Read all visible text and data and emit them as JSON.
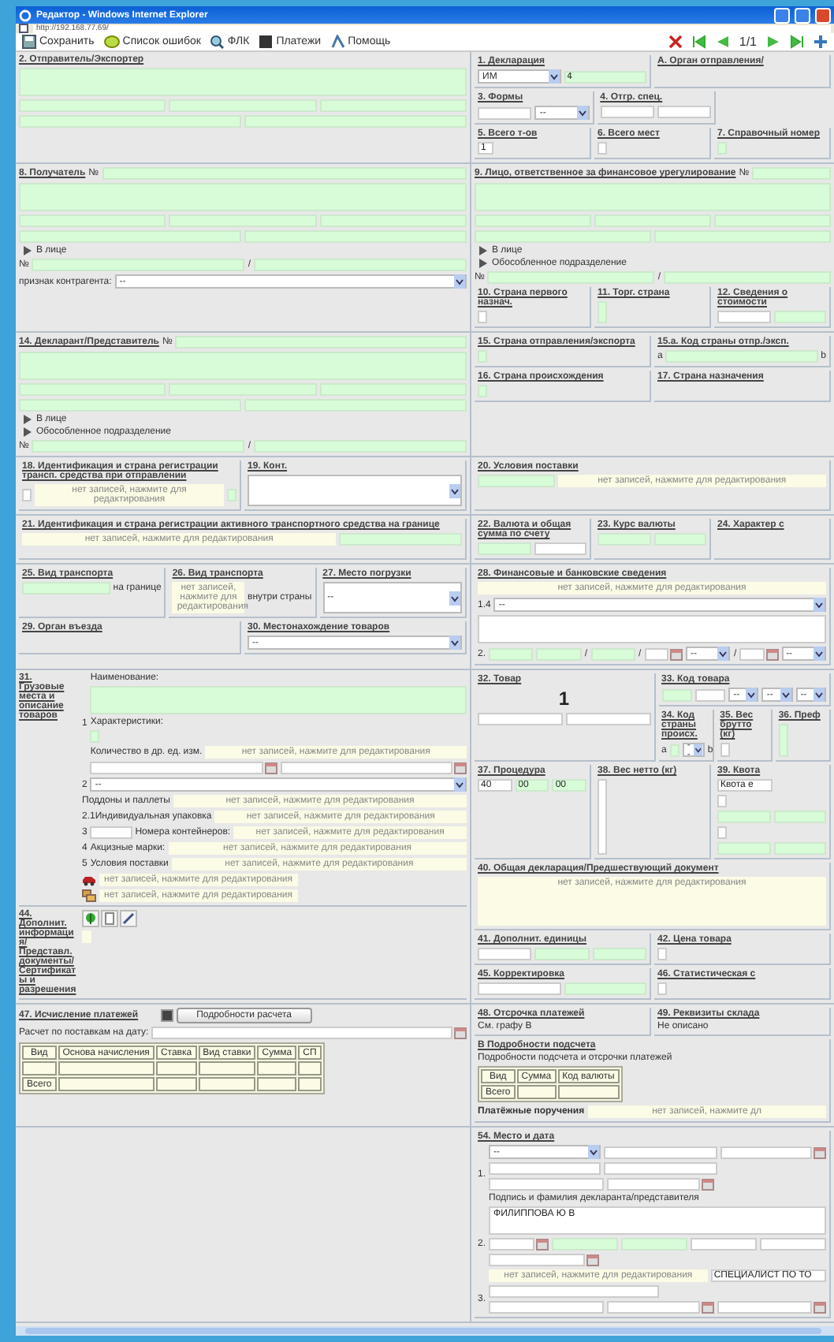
{
  "window": {
    "title": "Редактор - Windows Internet Explorer",
    "address": "http://192.168.77.69/"
  },
  "toolbar": {
    "buttons": [
      {
        "label": "Сохранить"
      },
      {
        "label": "Список ошибок"
      },
      {
        "label": "ФЛК"
      },
      {
        "label": "Платежи"
      },
      {
        "label": "Помощь"
      }
    ],
    "page": "1/1"
  },
  "bands": [
    {
      "left": [
        {
          "kind": "title",
          "text": "2. Отправитель/Экспортер"
        },
        {
          "kind": "textarea",
          "required": true
        },
        {
          "kind": "row",
          "children": [
            {
              "kind": "field",
              "required": true
            },
            {
              "kind": "field",
              "required": true
            },
            {
              "kind": "field",
              "required": true
            }
          ]
        },
        {
          "kind": "row",
          "children": [
            {
              "kind": "field",
              "required": true
            },
            {
              "kind": "field",
              "required": true
            }
          ]
        }
      ],
      "right": [
        {
          "kind": "row",
          "children": [
            {
              "kind": "cell",
              "title": "1. Декларация",
              "children": [
                {
                  "kind": "row",
                  "children": [
                    {
                      "kind": "select",
                      "value": "ИМ"
                    },
                    {
                      "kind": "field",
                      "required": true,
                      "value": "4"
                    }
                  ]
                }
              ]
            },
            {
              "kind": "cell",
              "title": "A. Орган отправления/"
            }
          ]
        },
        {
          "kind": "row",
          "children": [
            {
              "kind": "cell",
              "title": "3. Формы",
              "children": [
                {
                  "kind": "row",
                  "children": [
                    {
                      "kind": "field",
                      "required": false
                    },
                    {
                      "kind": "select",
                      "value": "--"
                    }
                  ]
                }
              ]
            },
            {
              "kind": "cell",
              "title": "4. Отгр. спец.",
              "children": [
                {
                  "kind": "row",
                  "children": [
                    {
                      "kind": "field",
                      "required": false
                    },
                    {
                      "kind": "field",
                      "required": false
                    }
                  ]
                }
              ]
            },
            {
              "kind": "cell"
            }
          ]
        },
        {
          "kind": "row",
          "children": [
            {
              "kind": "cell",
              "title": "5. Всего т-ов",
              "children": [
                {
                  "kind": "field",
                  "required": false,
                  "value": "1"
                }
              ]
            },
            {
              "kind": "cell",
              "title": "6. Всего мест",
              "children": [
                {
                  "kind": "field",
                  "required": false
                }
              ]
            },
            {
              "kind": "cell",
              "title": "7. Справочный номер",
              "children": [
                {
                  "kind": "field",
                  "required": true
                }
              ]
            }
          ]
        }
      ]
    },
    {
      "left": [
        {
          "kind": "row",
          "children": [
            {
              "kind": "title",
              "text": "8. Получатель"
            },
            {
              "kind": "text",
              "text": "№"
            },
            {
              "kind": "field",
              "required": true
            }
          ]
        },
        {
          "kind": "textarea",
          "required": true
        },
        {
          "kind": "row",
          "children": [
            {
              "kind": "field",
              "required": true
            },
            {
              "kind": "field",
              "required": true
            },
            {
              "kind": "field",
              "required": true
            }
          ]
        },
        {
          "kind": "row",
          "children": [
            {
              "kind": "field",
              "required": true
            },
            {
              "kind": "field",
              "required": true
            }
          ]
        },
        {
          "kind": "expander",
          "text": "В лице",
          "expanded": false
        },
        {
          "kind": "row",
          "children": [
            {
              "kind": "text",
              "text": "№"
            },
            {
              "kind": "field",
              "required": true
            },
            {
              "kind": "text",
              "text": "/"
            },
            {
              "kind": "field",
              "required": true
            }
          ]
        },
        {
          "kind": "row",
          "children": [
            {
              "kind": "text",
              "text": "признак контрагента:"
            },
            {
              "kind": "select",
              "value": "--"
            }
          ]
        }
      ],
      "right": [
        {
          "kind": "row",
          "children": [
            {
              "kind": "title",
              "text": "9. Лицо, ответственное за финансовое урегулирование"
            },
            {
              "kind": "text",
              "text": "№"
            },
            {
              "kind": "field",
              "required": true
            }
          ]
        },
        {
          "kind": "textarea",
          "required": true
        },
        {
          "kind": "row",
          "children": [
            {
              "kind": "field",
              "required": true
            },
            {
              "kind": "field",
              "required": true
            },
            {
              "kind": "field",
              "required": true
            }
          ]
        },
        {
          "kind": "row",
          "children": [
            {
              "kind": "field",
              "required": true
            },
            {
              "kind": "field",
              "required": true
            }
          ]
        },
        {
          "kind": "expander",
          "text": "В лице",
          "expanded": false
        },
        {
          "kind": "expander",
          "text": "Обособленное подразделение",
          "expanded": false
        },
        {
          "kind": "row",
          "children": [
            {
              "kind": "text",
              "text": "№"
            },
            {
              "kind": "field",
              "required": true
            },
            {
              "kind": "text",
              "text": "/"
            },
            {
              "kind": "field",
              "required": true
            }
          ]
        },
        {
          "kind": "row",
          "children": [
            {
              "kind": "cell",
              "title": "10. Страна первого назнач.",
              "children": [
                {
                  "kind": "field",
                  "required": false
                }
              ]
            },
            {
              "kind": "cell",
              "title": "11. Торг. страна",
              "children": [
                {
                  "kind": "field",
                  "required": true
                }
              ]
            },
            {
              "kind": "cell",
              "title": "12. Сведения о стоимости",
              "children": [
                {
                  "kind": "row",
                  "children": [
                    {
                      "kind": "field",
                      "required": false
                    },
                    {
                      "kind": "field",
                      "required": true
                    }
                  ]
                }
              ]
            }
          ]
        }
      ]
    },
    {
      "left": [
        {
          "kind": "row",
          "children": [
            {
              "kind": "title",
              "text": "14. Декларант/Представитель"
            },
            {
              "kind": "text",
              "text": "№"
            },
            {
              "kind": "field",
              "required": true
            }
          ]
        },
        {
          "kind": "textarea",
          "required": true
        },
        {
          "kind": "row",
          "children": [
            {
              "kind": "field",
              "required": true
            },
            {
              "kind": "field",
              "required": true
            },
            {
              "kind": "field",
              "required": true
            }
          ]
        },
        {
          "kind": "row",
          "children": [
            {
              "kind": "field",
              "required": true
            },
            {
              "kind": "field",
              "required": true
            }
          ]
        },
        {
          "kind": "expander",
          "text": "В лице",
          "expanded": false
        },
        {
          "kind": "expander",
          "text": "Обособленное подразделение",
          "expanded": false
        },
        {
          "kind": "row",
          "children": [
            {
              "kind": "text",
              "text": "№"
            },
            {
              "kind": "field",
              "required": true
            },
            {
              "kind": "text",
              "text": "/"
            },
            {
              "kind": "field",
              "required": true
            }
          ]
        }
      ],
      "right": [
        {
          "kind": "row",
          "children": [
            {
              "kind": "cell",
              "title": "15. Страна отправления/экспорта",
              "children": [
                {
                  "kind": "field",
                  "required": true
                }
              ]
            },
            {
              "kind": "cell",
              "title": "15.a. Код страны отпр./эксп.",
              "children": [
                {
                  "kind": "row",
                  "children": [
                    {
                      "kind": "text",
                      "text": "a"
                    },
                    {
                      "kind": "field",
                      "required": true
                    },
                    {
                      "kind": "text",
                      "text": "b"
                    }
                  ]
                }
              ]
            }
          ]
        },
        {
          "kind": "row",
          "children": [
            {
              "kind": "cell",
              "title": "16. Страна происхождения",
              "children": [
                {
                  "kind": "field",
                  "required": true
                }
              ]
            },
            {
              "kind": "cell",
              "title": "17. Страна назначения"
            }
          ]
        }
      ]
    },
    {
      "left": [
        {
          "kind": "row",
          "children": [
            {
              "kind": "cell",
              "title": "18. Идентификация и страна регистрации трансп. средства при отправлении",
              "children": [
                {
                  "kind": "row",
                  "children": [
                    {
                      "kind": "field",
                      "required": false
                    },
                    {
                      "kind": "note",
                      "text": "нет записей, нажмите для редактирования"
                    },
                    {
                      "kind": "field",
                      "required": true
                    }
                  ]
                }
              ]
            },
            {
              "kind": "cell",
              "title": "19. Конт.",
              "children": [
                {
                  "kind": "select"
                }
              ]
            }
          ]
        }
      ],
      "right": [
        {
          "kind": "cell",
          "title": "20. Условия поставки",
          "children": [
            {
              "kind": "row",
              "children": [
                {
                  "kind": "field",
                  "required": true
                },
                {
                  "kind": "note",
                  "text": "нет записей, нажмите для редактирования"
                }
              ]
            }
          ]
        }
      ]
    },
    {
      "left": [
        {
          "kind": "cell",
          "title": "21. Идентификация и страна регистрации активного транспортного средства на границе",
          "children": [
            {
              "kind": "row",
              "children": [
                {
                  "kind": "note",
                  "text": "нет записей, нажмите для редактирования"
                },
                {
                  "kind": "field",
                  "required": true
                }
              ]
            }
          ]
        }
      ],
      "right": [
        {
          "kind": "row",
          "children": [
            {
              "kind": "cell",
              "title": "22. Валюта и общая сумма по счету",
              "children": [
                {
                  "kind": "row",
                  "children": [
                    {
                      "kind": "field",
                      "required": true
                    },
                    {
                      "kind": "field",
                      "required": false
                    }
                  ]
                }
              ]
            },
            {
              "kind": "cell",
              "title": "23. Курс валюты",
              "children": [
                {
                  "kind": "row",
                  "children": [
                    {
                      "kind": "field",
                      "required": true
                    },
                    {
                      "kind": "field",
                      "required": true
                    }
                  ]
                }
              ]
            },
            {
              "kind": "cell",
              "title": "24. Характер с"
            }
          ]
        }
      ]
    },
    {
      "left": [
        {
          "kind": "row",
          "children": [
            {
              "kind": "cell",
              "title": "25. Вид транспорта",
              "children": [
                {
                  "kind": "row",
                  "children": [
                    {
                      "kind": "field",
                      "required": true
                    },
                    {
                      "kind": "text",
                      "text": "на границе"
                    }
                  ]
                }
              ]
            },
            {
              "kind": "cell",
              "title": "26. Вид транспорта",
              "children": [
                {
                  "kind": "row",
                  "children": [
                    {
                      "kind": "note",
                      "text": "нет записей, нажмите для редактирования"
                    },
                    {
                      "kind": "text",
                      "text": "внутри страны"
                    }
                  ]
                }
              ]
            },
            {
              "kind": "cell",
              "title": "27. Место погрузки",
              "children": [
                {
                  "kind": "select",
                  "value": "--"
                }
              ]
            }
          ]
        },
        {
          "kind": "row",
          "children": [
            {
              "kind": "cell",
              "title": "29. Орган въезда"
            },
            {
              "kind": "cell",
              "title": "30. Местонахождение товаров",
              "children": [
                {
                  "kind": "select",
                  "value": "--"
                }
              ]
            }
          ]
        }
      ],
      "right": [
        {
          "kind": "cell",
          "title": "28. Финансовые и банковские сведения",
          "children": [
            {
              "kind": "note",
              "text": "нет записей, нажмите для редактирования"
            },
            {
              "kind": "row",
              "children": [
                {
                  "kind": "text",
                  "text": "1.4"
                },
                {
                  "kind": "select",
                  "value": "--"
                }
              ]
            },
            {
              "kind": "textarea",
              "required": false
            },
            {
              "kind": "row",
              "children": [
                {
                  "kind": "text",
                  "text": "2."
                },
                {
                  "kind": "field",
                  "required": true
                },
                {
                  "kind": "field",
                  "required": true
                },
                {
                  "kind": "text",
                  "text": "/"
                },
                {
                  "kind": "field",
                  "required": true
                },
                {
                  "kind": "text",
                  "text": "/"
                },
                {
                  "kind": "date"
                },
                {
                  "kind": "select",
                  "value": "--"
                },
                {
                  "kind": "text",
                  "text": "/"
                },
                {
                  "kind": "date"
                },
                {
                  "kind": "select",
                  "value": "--"
                }
              ]
            }
          ]
        }
      ]
    },
    {
      "left": [
        {
          "kind": "side",
          "title": "31. Грузовые места и описание товаров",
          "children": [
            {
              "kind": "row",
              "children": [
                {
                  "kind": "text",
                  "text": "1"
                },
                {
                  "kind": "col",
                  "children": [
                    {
                      "kind": "text",
                      "text": "Наименование:"
                    },
                    {
                      "kind": "textarea",
                      "required": true
                    },
                    {
                      "kind": "text",
                      "text": "Характеристики:"
                    },
                    {
                      "kind": "field",
                      "required": true
                    },
                    {
                      "kind": "row",
                      "children": [
                        {
                          "kind": "text",
                          "text": "Количество в др. ед. изм."
                        },
                        {
                          "kind": "note",
                          "text": "нет записей, нажмите для редактирования"
                        }
                      ]
                    },
                    {
                      "kind": "row",
                      "children": [
                        {
                          "kind": "date"
                        },
                        {
                          "kind": "date"
                        }
                      ]
                    }
                  ]
                }
              ]
            },
            {
              "kind": "row",
              "children": [
                {
                  "kind": "text",
                  "text": "2"
                },
                {
                  "kind": "select",
                  "value": "--"
                }
              ]
            },
            {
              "kind": "row",
              "children": [
                {
                  "kind": "text",
                  "text": "Поддоны и паллеты"
                },
                {
                  "kind": "note",
                  "text": "нет записей, нажмите для редактирования"
                }
              ]
            },
            {
              "kind": "row",
              "children": [
                {
                  "kind": "text",
                  "text": "2.1Индивидуальная упаковка"
                },
                {
                  "kind": "note",
                  "text": "нет записей, нажмите для редактирования"
                }
              ]
            },
            {
              "kind": "row",
              "children": [
                {
                  "kind": "text",
                  "text": "3"
                },
                {
                  "kind": "field",
                  "required": false
                },
                {
                  "kind": "text",
                  "text": "Номера контейнеров:"
                },
                {
                  "kind": "note",
                  "text": "нет записей, нажмите для редактирования"
                }
              ]
            },
            {
              "kind": "row",
              "children": [
                {
                  "kind": "text",
                  "text": "4"
                },
                {
                  "kind": "text",
                  "text": "Акцизные марки:"
                },
                {
                  "kind": "note",
                  "text": "нет записей, нажмите для редактирования"
                }
              ]
            },
            {
              "kind": "row",
              "children": [
                {
                  "kind": "text",
                  "text": "5"
                },
                {
                  "kind": "text",
                  "text": "Условия поставки"
                },
                {
                  "kind": "note",
                  "text": "нет записей, нажмите для редактирования"
                }
              ]
            },
            {
              "kind": "vehicle",
              "text": "нет записей, нажмите для редактирования"
            },
            {
              "kind": "cargo",
              "text": "нет записей, нажмите для редактирования"
            }
          ]
        },
        {
          "kind": "side",
          "title": "44. Дополнит. информация/ Представл. документы/ Сертификаты и разрешения",
          "children": [
            {
              "kind": "iconbar"
            }
          ]
        }
      ],
      "right": [
        {
          "kind": "row",
          "children": [
            {
              "kind": "cell",
              "title": "32. Товар",
              "children": [
                {
                  "kind": "number",
                  "text": "1"
                },
                {
                  "kind": "row",
                  "children": [
                    {
                      "kind": "field",
                      "required": false
                    },
                    {
                      "kind": "field",
                      "required": false
                    }
                  ]
                }
              ]
            },
            {
              "kind": "col",
              "children": [
                {
                  "kind": "cell",
                  "title": "33. Код товара",
                  "children": [
                    {
                      "kind": "row",
                      "children": [
                        {
                          "kind": "field",
                          "required": true
                        },
                        {
                          "kind": "field",
                          "required": false
                        },
                        {
                          "kind": "select",
                          "value": "--"
                        },
                        {
                          "kind": "select",
                          "value": "--"
                        },
                        {
                          "kind": "select",
                          "value": "--"
                        }
                      ]
                    }
                  ]
                },
                {
                  "kind": "row",
                  "children": [
                    {
                      "kind": "cell",
                      "title": "34. Код страны происх.",
                      "children": [
                        {
                          "kind": "row",
                          "children": [
                            {
                              "kind": "text",
                              "text": "a"
                            },
                            {
                              "kind": "field",
                              "required": true
                            },
                            {
                              "kind": "select",
                              "value": "--"
                            },
                            {
                              "kind": "text",
                              "text": "b"
                            }
                          ]
                        }
                      ]
                    },
                    {
                      "kind": "cell",
                      "title": "35. Вес брутто (кг)",
                      "children": [
                        {
                          "kind": "field",
                          "required": false
                        }
                      ]
                    },
                    {
                      "kind": "cell",
                      "title": "36. Преф",
                      "children": [
                        {
                          "kind": "field",
                          "required": true
                        }
                      ]
                    }
                  ]
                }
              ]
            }
          ]
        },
        {
          "kind": "row",
          "children": [
            {
              "kind": "cell",
              "title": "37. Процедура",
              "children": [
                {
                  "kind": "row",
                  "children": [
                    {
                      "kind": "field",
                      "required": false,
                      "value": "40"
                    },
                    {
                      "kind": "field",
                      "required": true,
                      "value": "00"
                    },
                    {
                      "kind": "field",
                      "required": true,
                      "value": "00"
                    }
                  ]
                }
              ]
            },
            {
              "kind": "cell",
              "title": "38. Вес нетто (кг)",
              "children": [
                {
                  "kind": "field",
                  "required": false
                }
              ]
            },
            {
              "kind": "cell",
              "title": "39. Квота",
              "children": [
                {
                  "kind": "field",
                  "required": false,
                  "value": "Квота е"
                },
                {
                  "kind": "field",
                  "required": false
                },
                {
                  "kind": "row",
                  "children": [
                    {
                      "kind": "field",
                      "required": true
                    },
                    {
                      "kind": "field",
                      "required": true
                    }
                  ]
                },
                {
                  "kind": "field",
                  "required": false
                },
                {
                  "kind": "row",
                  "children": [
                    {
                      "kind": "field",
                      "required": true
                    },
                    {
                      "kind": "field",
                      "required": true
                    }
                  ]
                }
              ]
            }
          ]
        },
        {
          "kind": "cell",
          "title": "40. Общая декларация/Предшествующий документ",
          "children": [
            {
              "kind": "note",
              "text": "нет записей, нажмите для редактирования"
            }
          ]
        },
        {
          "kind": "row",
          "children": [
            {
              "kind": "cell",
              "title": "41. Дополнит. единицы",
              "children": [
                {
                  "kind": "row",
                  "children": [
                    {
                      "kind": "field",
                      "required": false
                    },
                    {
                      "kind": "field",
                      "required": true
                    },
                    {
                      "kind": "field",
                      "required": true
                    }
                  ]
                }
              ]
            },
            {
              "kind": "cell",
              "title": "42. Цена товара",
              "children": [
                {
                  "kind": "field",
                  "required": false
                }
              ]
            }
          ]
        },
        {
          "kind": "row",
          "children": [
            {
              "kind": "cell",
              "title": "45. Корректировка",
              "children": [
                {
                  "kind": "row",
                  "children": [
                    {
                      "kind": "field",
                      "required": false
                    },
                    {
                      "kind": "field",
                      "required": true
                    }
                  ]
                }
              ]
            },
            {
              "kind": "cell",
              "title": "46. Статистическая с",
              "children": [
                {
                  "kind": "field",
                  "required": false
                }
              ]
            }
          ]
        }
      ]
    },
    {
      "left": [
        {
          "kind": "row",
          "children": [
            {
              "kind": "title",
              "text": "47. Исчисление платежей"
            },
            {
              "kind": "button",
              "text": "Подробности расчета"
            }
          ]
        },
        {
          "kind": "row",
          "children": [
            {
              "kind": "text",
              "text": "Расчет по поставкам на дату:"
            },
            {
              "kind": "date"
            }
          ]
        },
        {
          "kind": "table",
          "columns": [
            "Вид",
            "Основа начисления",
            "Ставка",
            "Вид ставки",
            "Сумма",
            "СП"
          ],
          "rows": [
            {
              "kind": "blank"
            },
            {
              "kind": "total",
              "label": "Всего"
            }
          ]
        }
      ],
      "right": [
        {
          "kind": "row",
          "children": [
            {
              "kind": "cell",
              "title": "48. Отсрочка платежей",
              "children": [
                {
                  "kind": "text",
                  "text": "См. графу B"
                }
              ]
            },
            {
              "kind": "cell",
              "title": "49. Реквизиты склада",
              "children": [
                {
                  "kind": "text",
                  "text": "Не описано"
                }
              ]
            }
          ]
        },
        {
          "kind": "cell",
          "title": "B Подробности подсчета",
          "children": [
            {
              "kind": "text",
              "text": "Подробности подсчета и отсрочки платежей"
            },
            {
              "kind": "table",
              "columns": [
                "Вид",
                "Сумма",
                "Код валюты"
              ],
              "rows": [
                {
                  "kind": "total",
                  "label": "Всего"
                }
              ]
            },
            {
              "kind": "row",
              "children": [
                {
                  "kind": "heading",
                  "text": "Платёжные поручения"
                },
                {
                  "kind": "note",
                  "text": "нет записей, нажмите дл"
                }
              ]
            }
          ]
        }
      ]
    },
    {
      "right": [
        {
          "kind": "cell",
          "title": "54. Место и дата",
          "children": [
            {
              "kind": "row",
              "children": [
                {
                  "kind": "text",
                  "text": "1."
                },
                {
                  "kind": "col",
                  "children": [
                    {
                      "kind": "row",
                      "children": [
                        {
                          "kind": "select",
                          "value": "--"
                        },
                        {
                          "kind": "field",
                          "required": false
                        },
                        {
                          "kind": "date"
                        }
                      ]
                    },
                    {
                      "kind": "row",
                      "children": [
                        {
                          "kind": "field",
                          "required": false
                        },
                        {
                          "kind": "field",
                          "required": false
                        },
                        {
                          "kind": "spacer"
                        }
                      ]
                    },
                    {
                      "kind": "row",
                      "children": [
                        {
                          "kind": "field",
                          "required": false
                        },
                        {
                          "kind": "date"
                        },
                        {
                          "kind": "spacer"
                        }
                      ]
                    },
                    {
                      "kind": "text",
                      "text": "Подпись и фамилия декларанта/представителя"
                    }
                  ]
                }
              ]
            },
            {
              "kind": "row",
              "children": [
                {
                  "kind": "text",
                  "text": "2."
                },
                {
                  "kind": "col",
                  "children": [
                    {
                      "kind": "textarea",
                      "required": false,
                      "value": "ФИЛИППОВА Ю В"
                    },
                    {
                      "kind": "row",
                      "children": [
                        {
                          "kind": "date"
                        },
                        {
                          "kind": "field",
                          "required": true
                        },
                        {
                          "kind": "field",
                          "required": true
                        },
                        {
                          "kind": "field",
                          "required": false
                        },
                        {
                          "kind": "field",
                          "required": false
                        }
                      ]
                    },
                    {
                      "kind": "row",
                      "children": [
                        {
                          "kind": "date"
                        },
                        {
                          "kind": "spacer"
                        },
                        {
                          "kind": "spacer"
                        }
                      ]
                    },
                    {
                      "kind": "row",
                      "children": [
                        {
                          "kind": "note",
                          "text": "нет записей, нажмите для редактирования"
                        },
                        {
                          "kind": "field",
                          "required": false,
                          "value": "СПЕЦИАЛИСТ ПО ТО"
                        }
                      ]
                    }
                  ]
                }
              ]
            },
            {
              "kind": "row",
              "children": [
                {
                  "kind": "text",
                  "text": "3."
                },
                {
                  "kind": "col",
                  "children": [
                    {
                      "kind": "row",
                      "children": [
                        {
                          "kind": "field",
                          "required": false
                        },
                        {
                          "kind": "spacer"
                        }
                      ]
                    },
                    {
                      "kind": "row",
                      "children": [
                        {
                          "kind": "field",
                          "required": false
                        },
                        {
                          "kind": "date"
                        },
                        {
                          "kind": "date"
                        }
                      ]
                    }
                  ]
                }
              ]
            }
          ]
        }
      ]
    }
  ]
}
